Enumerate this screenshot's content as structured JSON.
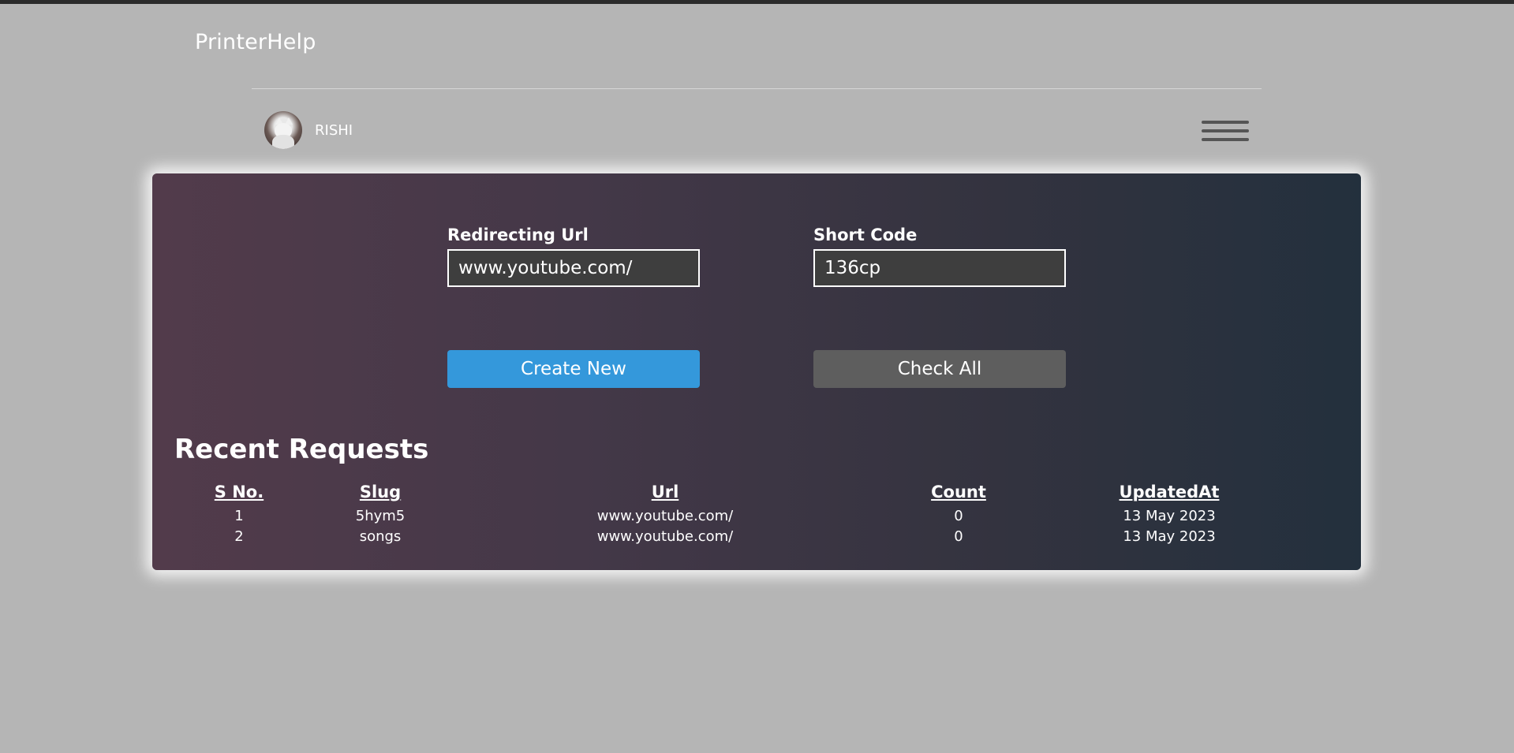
{
  "app": {
    "brand": "PrinterHelp"
  },
  "user": {
    "name": "RISHI"
  },
  "form": {
    "redirect_label": "Redirecting Url",
    "redirect_value": "www.youtube.com/",
    "code_label": "Short Code",
    "code_value": "136cp",
    "create_label": "Create New",
    "check_label": "Check All"
  },
  "recent": {
    "title": "Recent Requests",
    "columns": [
      "S No.",
      "Slug",
      "Url",
      "Count",
      "UpdatedAt"
    ],
    "rows": [
      [
        "1",
        "5hym5",
        "www.youtube.com/",
        "0",
        "13 May 2023"
      ],
      [
        "2",
        "songs",
        "www.youtube.com/",
        "0",
        "13 May 2023"
      ]
    ]
  },
  "colors": {
    "page_bg": "#b5b5b5",
    "primary_button": "#3498db",
    "secondary_button": "#5e5e5e",
    "card_gradient_start": "#523b4b",
    "card_gradient_end": "#23303d"
  }
}
